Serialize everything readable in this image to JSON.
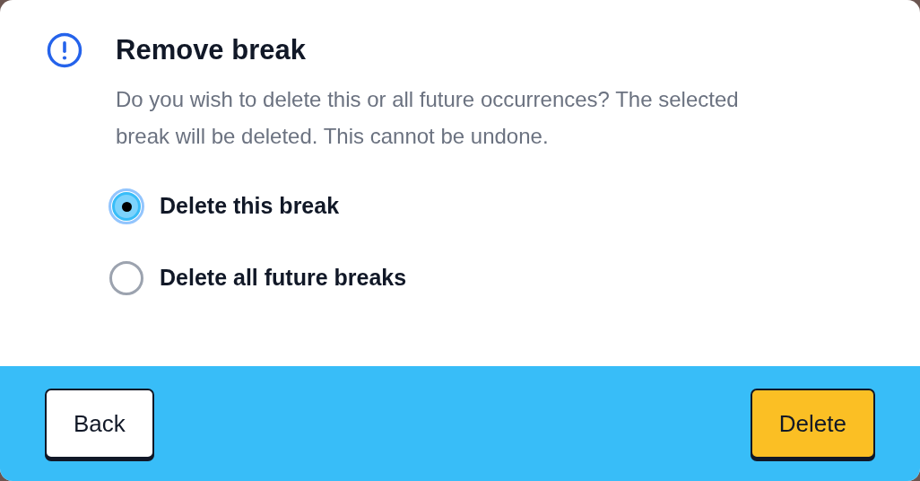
{
  "dialog": {
    "title": "Remove break",
    "message": "Do you wish to delete this or all future occurrences? The selected break will be deleted. This cannot be undone.",
    "options": [
      {
        "label": "Delete this break",
        "selected": true
      },
      {
        "label": "Delete all future breaks",
        "selected": false
      }
    ],
    "buttons": [
      {
        "label": "Back",
        "kind": "secondary"
      },
      {
        "label": "Delete",
        "kind": "primary"
      }
    ]
  }
}
